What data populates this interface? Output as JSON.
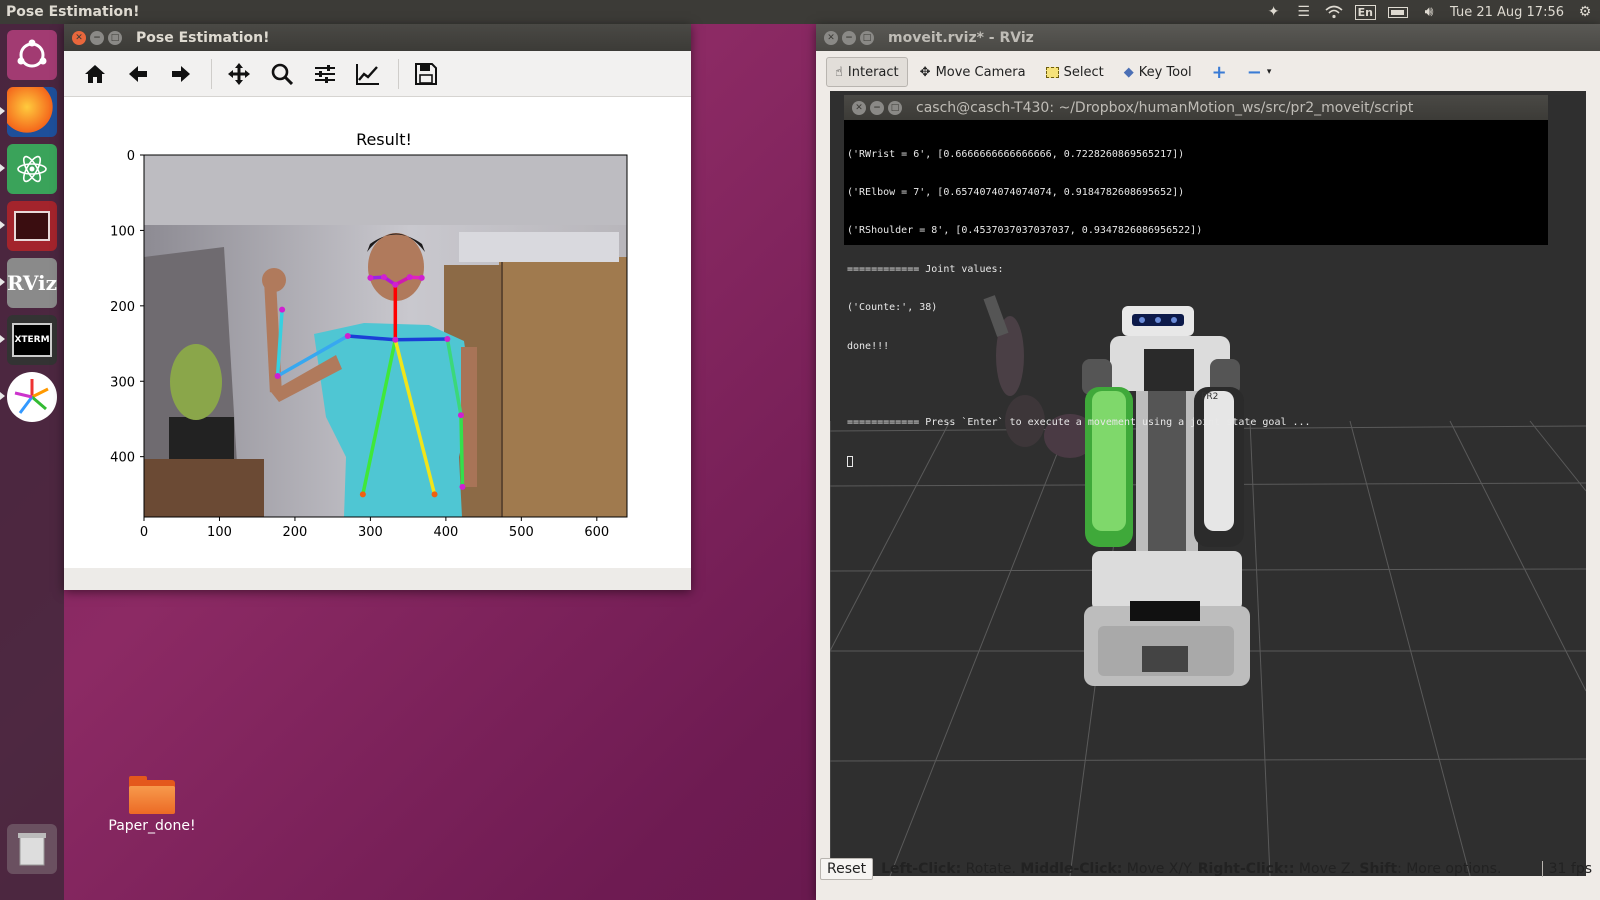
{
  "top_panel": {
    "app_title": "Pose Estimation!",
    "keyboard_layout": "En",
    "clock": "Tue 21 Aug 17:56"
  },
  "launcher": {
    "items": [
      {
        "name": "ubuntu-dash-icon",
        "label": ""
      },
      {
        "name": "firefox-icon",
        "label": ""
      },
      {
        "name": "atom-editor-icon",
        "label": ""
      },
      {
        "name": "terminal-app-icon",
        "label": ""
      },
      {
        "name": "rviz-app-icon",
        "label": "RViz"
      },
      {
        "name": "xterm-app-icon",
        "label": "XTERM"
      },
      {
        "name": "color-wheel-app-icon",
        "label": ""
      },
      {
        "name": "trash-icon",
        "label": ""
      }
    ]
  },
  "pose_window": {
    "title": "Pose Estimation!",
    "toolbar": [
      "home-icon",
      "back-arrow-icon",
      "forward-arrow-icon",
      "pan-icon",
      "zoom-icon",
      "subplots-config-icon",
      "edit-curve-icon",
      "save-icon"
    ]
  },
  "chart_data": {
    "type": "image",
    "title": "Result!",
    "xlabel": "",
    "ylabel": "",
    "xlim": [
      0,
      640
    ],
    "ylim": [
      480,
      0
    ],
    "x_ticks": [
      "0",
      "100",
      "200",
      "300",
      "400",
      "500",
      "600"
    ],
    "y_ticks": [
      "0",
      "100",
      "200",
      "300",
      "400"
    ],
    "skeleton_keypoints": [
      {
        "name": "nose",
        "x": 333,
        "y": 172
      },
      {
        "name": "neck",
        "x": 333,
        "y": 245
      },
      {
        "name": "r-shoulder",
        "x": 270,
        "y": 240
      },
      {
        "name": "r-elbow",
        "x": 177,
        "y": 293
      },
      {
        "name": "r-wrist",
        "x": 183,
        "y": 205
      },
      {
        "name": "l-shoulder",
        "x": 402,
        "y": 244
      },
      {
        "name": "l-elbow",
        "x": 420,
        "y": 345
      },
      {
        "name": "l-wrist",
        "x": 422,
        "y": 440
      },
      {
        "name": "r-hip",
        "x": 290,
        "y": 450
      },
      {
        "name": "l-hip",
        "x": 385,
        "y": 450
      },
      {
        "name": "r-eye",
        "x": 318,
        "y": 162
      },
      {
        "name": "l-eye",
        "x": 352,
        "y": 162
      },
      {
        "name": "r-ear",
        "x": 300,
        "y": 163
      },
      {
        "name": "l-ear",
        "x": 368,
        "y": 163
      }
    ]
  },
  "rviz_window": {
    "title": "moveit.rviz* - RViz",
    "tools": [
      {
        "label": "Interact",
        "icon": "hand-cursor-icon",
        "active": true
      },
      {
        "label": "Move Camera",
        "icon": "move-camera-icon",
        "active": false
      },
      {
        "label": "Select",
        "icon": "select-box-icon",
        "active": false
      },
      {
        "label": "Key Tool",
        "icon": "key-tool-icon",
        "active": false
      }
    ],
    "status": {
      "reset_label": "Reset",
      "hint_left_click": "Left-Click:",
      "hint_rotate": " Rotate. ",
      "hint_middle_click": "Middle-Click:",
      "hint_move_xy": " Move X/Y. ",
      "hint_right_click": "Right-Click::",
      "hint_move_z": " Move Z. ",
      "hint_shift": "Shift",
      "hint_more": ": More options.",
      "fps": "31 fps"
    }
  },
  "terminal": {
    "title": "casch@casch-T430: ~/Dropbox/humanMotion_ws/src/pr2_moveit/script",
    "lines": [
      "('RWrist = 6', [0.6666666666666666, 0.7228260869565217])",
      "('RElbow = 7', [0.6574074074074074, 0.9184782608695652])",
      "('RShoulder = 8', [0.4537037037037037, 0.9347826086956522])",
      "============ Joint values:",
      "('Counte:', 38)",
      "done!!!",
      "",
      "============ Press `Enter` to execute a movement using a joint state goal ..."
    ]
  },
  "desktop": {
    "folder_label": "Paper_done!"
  },
  "robot_label": "PR2"
}
